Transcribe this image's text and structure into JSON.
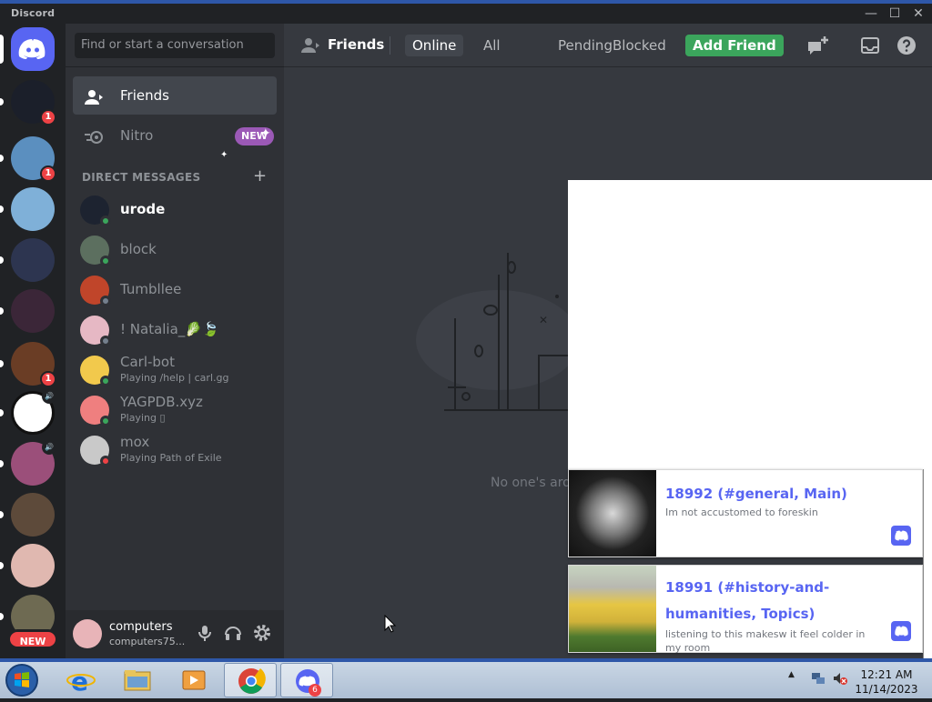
{
  "window": {
    "app_title": "Discord",
    "controls": {
      "minimize": "—",
      "maximize": "☐",
      "close": "✕"
    }
  },
  "servers": {
    "home_icon": "discord-logo-icon",
    "items": [
      {
        "name": "server-skull",
        "badge": "1",
        "color": "#1b1f2a"
      },
      {
        "name": "server-chat-art",
        "badge": "1",
        "color": "#5b8fbf"
      },
      {
        "name": "server-anime-blue",
        "badge": "",
        "color": "#7fb0d8"
      },
      {
        "name": "server-hooded-figure",
        "badge": "",
        "color": "#2d3550"
      },
      {
        "name": "server-dark-castle",
        "badge": "",
        "color": "#3b2638"
      },
      {
        "name": "server-portrait",
        "badge": "1",
        "color": "#6a3d25"
      },
      {
        "name": "server-spiral",
        "badge": "",
        "color": "#ffffff",
        "voice": true
      },
      {
        "name": "server-sunset",
        "badge": "",
        "color": "#9b4f7a",
        "voice": true
      },
      {
        "name": "server-circus",
        "badge": "",
        "color": "#5d4a3a"
      },
      {
        "name": "server-pink-blur",
        "badge": "",
        "color": "#e0b8b0"
      },
      {
        "name": "server-camo",
        "badge": "",
        "color": "#6e6a52"
      }
    ],
    "new_label": "NEW"
  },
  "sidebar": {
    "search_placeholder": "Find or start a conversation",
    "friends_label": "Friends",
    "nitro_label": "Nitro",
    "nitro_badge": "NEW",
    "dm_header": "DIRECT MESSAGES",
    "dm_add": "+",
    "dms": [
      {
        "name": "urode",
        "activity": "",
        "status": "online",
        "avatar": "#1d2330",
        "bright": true
      },
      {
        "name": "block",
        "activity": "",
        "status": "online",
        "avatar": "#5c6f5f"
      },
      {
        "name": "Tumbllee",
        "activity": "",
        "status": "offline",
        "avatar": "#c0452a"
      },
      {
        "name": "! Natalia_🥬🍃",
        "activity": "",
        "status": "offline",
        "avatar": "#e6b8c4"
      },
      {
        "name": "Carl-bot",
        "activity": "Playing /help | carl.gg",
        "status": "online",
        "avatar": "#f2c94c"
      },
      {
        "name": "YAGPDB.xyz",
        "activity": "Playing ▯",
        "status": "online",
        "avatar": "#ef7f7f"
      },
      {
        "name": "mox",
        "activity": "Playing Path of Exile",
        "status": "dnd",
        "avatar": "#c9c9c9"
      }
    ]
  },
  "user": {
    "name": "computers",
    "tag": "computers75..."
  },
  "main": {
    "title": "Friends",
    "tabs": {
      "online": "Online",
      "all": "All",
      "pending": "Pending",
      "blocked": "Blocked",
      "add_friend": "Add Friend"
    },
    "empty_text": "No one's aro"
  },
  "notifications": [
    {
      "title": "18992 (#general, Main)",
      "body": "Im not accustomed to foreskin"
    },
    {
      "title": "18991 (#history-and-humanities, Topics)",
      "body": "listening to this makesw it feel colder in my room"
    }
  ],
  "taskbar": {
    "discord_badge": "6",
    "time": "12:21 AM",
    "date": "11/14/2023"
  },
  "colors": {
    "blurple": "#5865f2",
    "online": "#3ba55c",
    "dnd": "#ed4245",
    "offline": "#747f8d",
    "nitro": "#9b59b6"
  }
}
